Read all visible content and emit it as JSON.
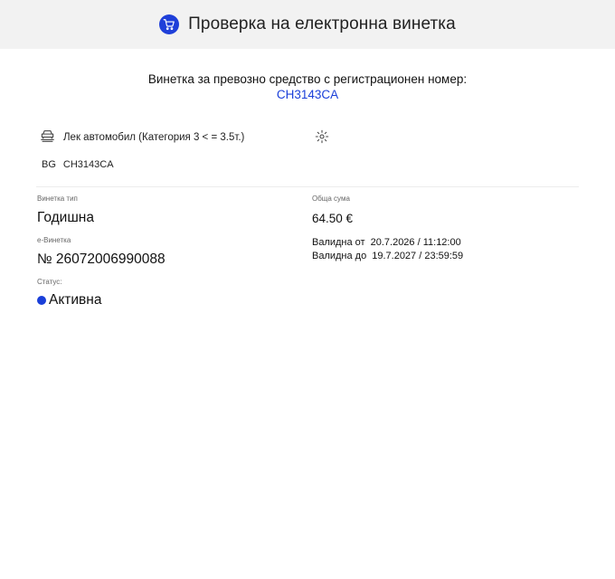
{
  "header": {
    "title": "Проверка на електронна винетка",
    "icon": "cart-icon"
  },
  "intro": {
    "text": "Винетка за превозно средство с регистрационен номер:",
    "plate": "CH3143CA"
  },
  "vehicle": {
    "category": "Лек автомобил (Категория 3 < = 3.5т.)",
    "country": "BG",
    "plate": "CH3143CA"
  },
  "details": {
    "type_label": "Винетка тип",
    "type_value": "Годишна",
    "evignette_label": "е-Винетка",
    "evignette_value": "№ 26072006990088",
    "status_label": "Статус:",
    "status_value": "Активна",
    "sum_label": "Обща сума",
    "sum_value": "64.50 €",
    "valid_from_label": "Валидна от",
    "valid_from_value": "20.7.2026 / 11:12:00",
    "valid_to_label": "Валидна до",
    "valid_to_value": "19.7.2027 / 23:59:59"
  },
  "colors": {
    "accent": "#1a3fd9",
    "header_bg": "#f2f2f2"
  }
}
